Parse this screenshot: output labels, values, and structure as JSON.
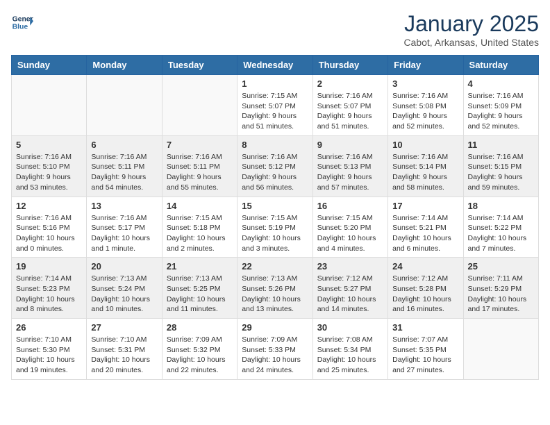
{
  "logo": {
    "line1": "General",
    "line2": "Blue"
  },
  "title": "January 2025",
  "location": "Cabot, Arkansas, United States",
  "days_of_week": [
    "Sunday",
    "Monday",
    "Tuesday",
    "Wednesday",
    "Thursday",
    "Friday",
    "Saturday"
  ],
  "weeks": [
    [
      {
        "day": "",
        "info": ""
      },
      {
        "day": "",
        "info": ""
      },
      {
        "day": "",
        "info": ""
      },
      {
        "day": "1",
        "info": "Sunrise: 7:15 AM\nSunset: 5:07 PM\nDaylight: 9 hours and 51 minutes."
      },
      {
        "day": "2",
        "info": "Sunrise: 7:16 AM\nSunset: 5:07 PM\nDaylight: 9 hours and 51 minutes."
      },
      {
        "day": "3",
        "info": "Sunrise: 7:16 AM\nSunset: 5:08 PM\nDaylight: 9 hours and 52 minutes."
      },
      {
        "day": "4",
        "info": "Sunrise: 7:16 AM\nSunset: 5:09 PM\nDaylight: 9 hours and 52 minutes."
      }
    ],
    [
      {
        "day": "5",
        "info": "Sunrise: 7:16 AM\nSunset: 5:10 PM\nDaylight: 9 hours and 53 minutes."
      },
      {
        "day": "6",
        "info": "Sunrise: 7:16 AM\nSunset: 5:11 PM\nDaylight: 9 hours and 54 minutes."
      },
      {
        "day": "7",
        "info": "Sunrise: 7:16 AM\nSunset: 5:11 PM\nDaylight: 9 hours and 55 minutes."
      },
      {
        "day": "8",
        "info": "Sunrise: 7:16 AM\nSunset: 5:12 PM\nDaylight: 9 hours and 56 minutes."
      },
      {
        "day": "9",
        "info": "Sunrise: 7:16 AM\nSunset: 5:13 PM\nDaylight: 9 hours and 57 minutes."
      },
      {
        "day": "10",
        "info": "Sunrise: 7:16 AM\nSunset: 5:14 PM\nDaylight: 9 hours and 58 minutes."
      },
      {
        "day": "11",
        "info": "Sunrise: 7:16 AM\nSunset: 5:15 PM\nDaylight: 9 hours and 59 minutes."
      }
    ],
    [
      {
        "day": "12",
        "info": "Sunrise: 7:16 AM\nSunset: 5:16 PM\nDaylight: 10 hours and 0 minutes."
      },
      {
        "day": "13",
        "info": "Sunrise: 7:16 AM\nSunset: 5:17 PM\nDaylight: 10 hours and 1 minute."
      },
      {
        "day": "14",
        "info": "Sunrise: 7:15 AM\nSunset: 5:18 PM\nDaylight: 10 hours and 2 minutes."
      },
      {
        "day": "15",
        "info": "Sunrise: 7:15 AM\nSunset: 5:19 PM\nDaylight: 10 hours and 3 minutes."
      },
      {
        "day": "16",
        "info": "Sunrise: 7:15 AM\nSunset: 5:20 PM\nDaylight: 10 hours and 4 minutes."
      },
      {
        "day": "17",
        "info": "Sunrise: 7:14 AM\nSunset: 5:21 PM\nDaylight: 10 hours and 6 minutes."
      },
      {
        "day": "18",
        "info": "Sunrise: 7:14 AM\nSunset: 5:22 PM\nDaylight: 10 hours and 7 minutes."
      }
    ],
    [
      {
        "day": "19",
        "info": "Sunrise: 7:14 AM\nSunset: 5:23 PM\nDaylight: 10 hours and 8 minutes."
      },
      {
        "day": "20",
        "info": "Sunrise: 7:13 AM\nSunset: 5:24 PM\nDaylight: 10 hours and 10 minutes."
      },
      {
        "day": "21",
        "info": "Sunrise: 7:13 AM\nSunset: 5:25 PM\nDaylight: 10 hours and 11 minutes."
      },
      {
        "day": "22",
        "info": "Sunrise: 7:13 AM\nSunset: 5:26 PM\nDaylight: 10 hours and 13 minutes."
      },
      {
        "day": "23",
        "info": "Sunrise: 7:12 AM\nSunset: 5:27 PM\nDaylight: 10 hours and 14 minutes."
      },
      {
        "day": "24",
        "info": "Sunrise: 7:12 AM\nSunset: 5:28 PM\nDaylight: 10 hours and 16 minutes."
      },
      {
        "day": "25",
        "info": "Sunrise: 7:11 AM\nSunset: 5:29 PM\nDaylight: 10 hours and 17 minutes."
      }
    ],
    [
      {
        "day": "26",
        "info": "Sunrise: 7:10 AM\nSunset: 5:30 PM\nDaylight: 10 hours and 19 minutes."
      },
      {
        "day": "27",
        "info": "Sunrise: 7:10 AM\nSunset: 5:31 PM\nDaylight: 10 hours and 20 minutes."
      },
      {
        "day": "28",
        "info": "Sunrise: 7:09 AM\nSunset: 5:32 PM\nDaylight: 10 hours and 22 minutes."
      },
      {
        "day": "29",
        "info": "Sunrise: 7:09 AM\nSunset: 5:33 PM\nDaylight: 10 hours and 24 minutes."
      },
      {
        "day": "30",
        "info": "Sunrise: 7:08 AM\nSunset: 5:34 PM\nDaylight: 10 hours and 25 minutes."
      },
      {
        "day": "31",
        "info": "Sunrise: 7:07 AM\nSunset: 5:35 PM\nDaylight: 10 hours and 27 minutes."
      },
      {
        "day": "",
        "info": ""
      }
    ]
  ]
}
